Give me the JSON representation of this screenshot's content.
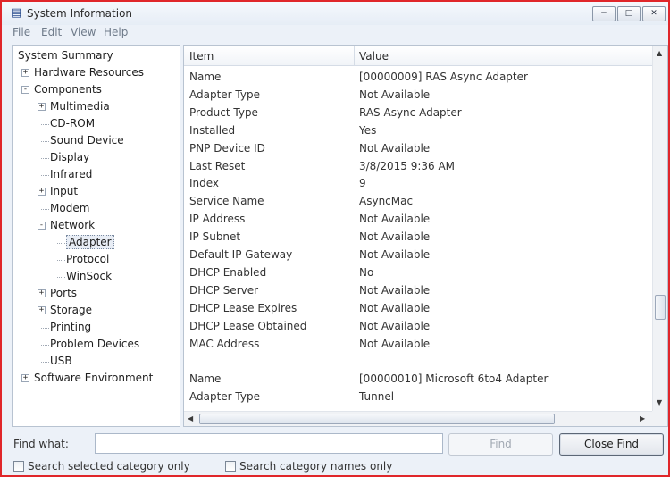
{
  "window": {
    "title": "System Information",
    "app_icon": "sysinfo-icon",
    "controls": {
      "minimize": "minimize-icon",
      "maximize": "maximize-icon",
      "close": "close-icon"
    }
  },
  "menubar": {
    "items": [
      "File",
      "Edit",
      "View",
      "Help"
    ]
  },
  "tree": {
    "nodes": [
      {
        "label": "System Summary",
        "level": 0,
        "expander": ""
      },
      {
        "label": "Hardware Resources",
        "level": 1,
        "expander": "+"
      },
      {
        "label": "Components",
        "level": 1,
        "expander": "-"
      },
      {
        "label": "Multimedia",
        "level": 2,
        "expander": "+"
      },
      {
        "label": "CD-ROM",
        "level": 2,
        "expander": ""
      },
      {
        "label": "Sound Device",
        "level": 2,
        "expander": ""
      },
      {
        "label": "Display",
        "level": 2,
        "expander": ""
      },
      {
        "label": "Infrared",
        "level": 2,
        "expander": ""
      },
      {
        "label": "Input",
        "level": 2,
        "expander": "+"
      },
      {
        "label": "Modem",
        "level": 2,
        "expander": ""
      },
      {
        "label": "Network",
        "level": 2,
        "expander": "-"
      },
      {
        "label": "Adapter",
        "level": 3,
        "expander": "",
        "selected": true
      },
      {
        "label": "Protocol",
        "level": 3,
        "expander": ""
      },
      {
        "label": "WinSock",
        "level": 3,
        "expander": ""
      },
      {
        "label": "Ports",
        "level": 2,
        "expander": "+"
      },
      {
        "label": "Storage",
        "level": 2,
        "expander": "+"
      },
      {
        "label": "Printing",
        "level": 2,
        "expander": ""
      },
      {
        "label": "Problem Devices",
        "level": 2,
        "expander": ""
      },
      {
        "label": "USB",
        "level": 2,
        "expander": ""
      },
      {
        "label": "Software Environment",
        "level": 1,
        "expander": "+"
      }
    ]
  },
  "details": {
    "columns": [
      "Item",
      "Value"
    ],
    "rows": [
      [
        "Name",
        "[00000009] RAS Async Adapter"
      ],
      [
        "Adapter Type",
        "Not Available"
      ],
      [
        "Product Type",
        "RAS Async Adapter"
      ],
      [
        "Installed",
        "Yes"
      ],
      [
        "PNP Device ID",
        "Not Available"
      ],
      [
        "Last Reset",
        "3/8/2015 9:36 AM"
      ],
      [
        "Index",
        "9"
      ],
      [
        "Service Name",
        "AsyncMac"
      ],
      [
        "IP Address",
        "Not Available"
      ],
      [
        "IP Subnet",
        "Not Available"
      ],
      [
        "Default IP Gateway",
        "Not Available"
      ],
      [
        "DHCP Enabled",
        "No"
      ],
      [
        "DHCP Server",
        "Not Available"
      ],
      [
        "DHCP Lease Expires",
        "Not Available"
      ],
      [
        "DHCP Lease Obtained",
        "Not Available"
      ],
      [
        "MAC Address",
        "Not Available"
      ],
      [
        "",
        ""
      ],
      [
        "Name",
        "[00000010] Microsoft 6to4 Adapter"
      ],
      [
        "Adapter Type",
        "Tunnel"
      ]
    ]
  },
  "find": {
    "label": "Find what:",
    "value": "",
    "find_button": "Find",
    "close_find_button": "Close Find",
    "option_selected_category": "Search selected category only",
    "option_category_names": "Search category names only"
  }
}
